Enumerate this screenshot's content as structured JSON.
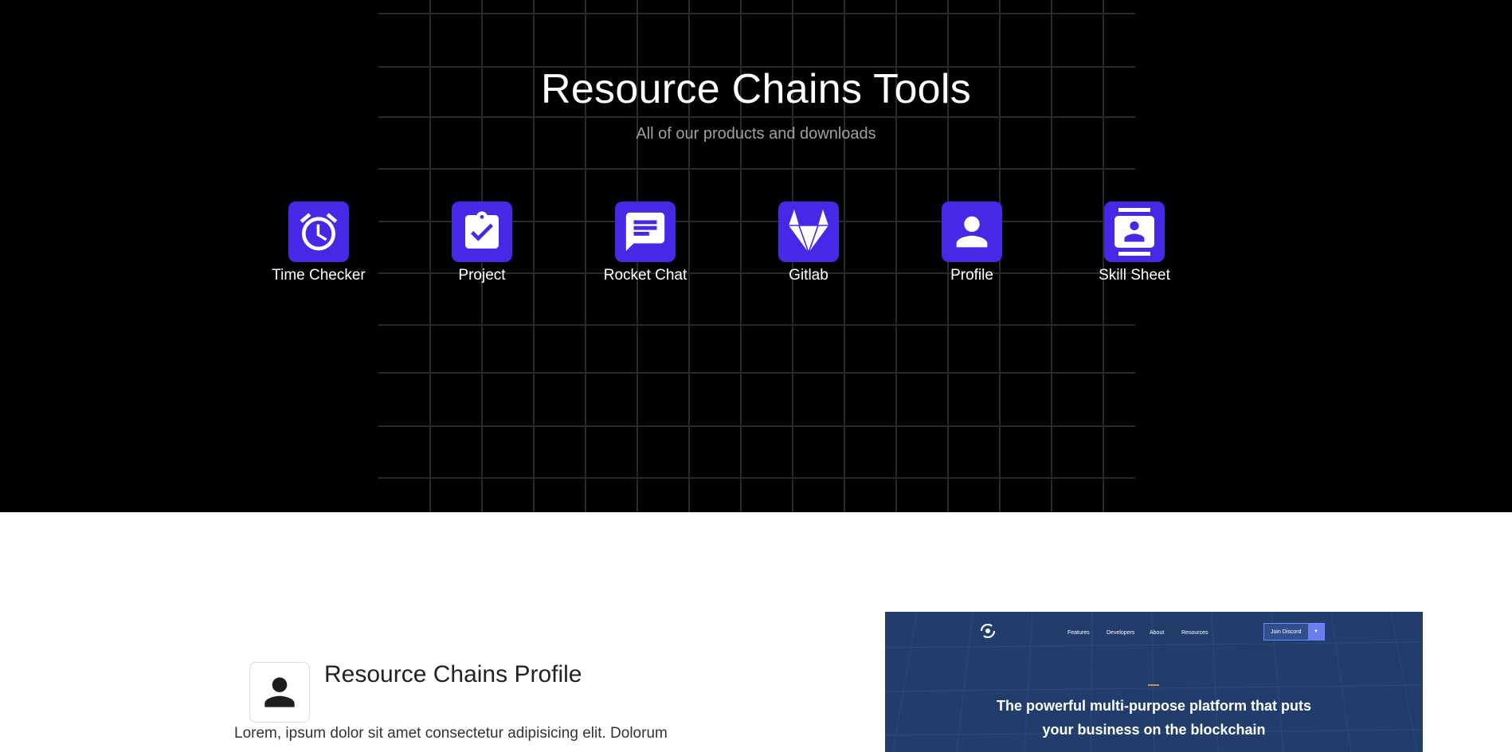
{
  "hero": {
    "title": "Resource Chains Tools",
    "subtitle": "All of our products and downloads"
  },
  "tools": [
    {
      "label": "Time Checker",
      "icon": "alarm-clock-icon"
    },
    {
      "label": "Project",
      "icon": "clipboard-check-icon"
    },
    {
      "label": "Rocket Chat",
      "icon": "chat-icon"
    },
    {
      "label": "Gitlab",
      "icon": "gitlab-icon"
    },
    {
      "label": "Profile",
      "icon": "person-icon"
    },
    {
      "label": "Skill Sheet",
      "icon": "contact-card-icon"
    }
  ],
  "profile_section": {
    "title": "Resource Chains Profile",
    "text": "Lorem, ipsum dolor sit amet consectetur adipisicing elit. Dolorum",
    "icon": "person-icon"
  },
  "preview": {
    "nav": [
      "Features",
      "Developers",
      "About",
      "Resources"
    ],
    "cta": "Join Discord",
    "headline_line1": "The powerful multi-purpose platform that puts",
    "headline_line2": "your business on the blockchain"
  },
  "colors": {
    "accent": "#4629e6",
    "hero_bg": "#000000",
    "preview_bg": "#223d6c"
  }
}
